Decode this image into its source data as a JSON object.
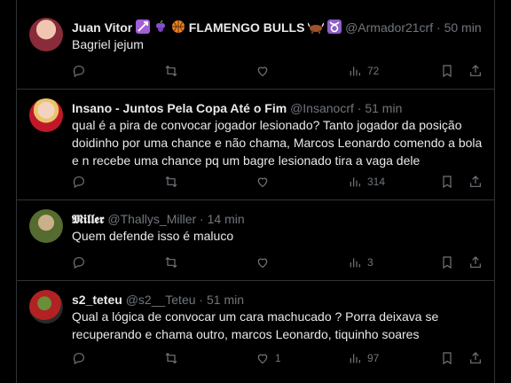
{
  "tweets": [
    {
      "name": "Juan Vitor",
      "name_tail": "FLAMENGO BULLS",
      "handle": "@Armador21crf",
      "time": "50 min",
      "text": "Bagriel jejum",
      "likes": "",
      "views": "72"
    },
    {
      "name": "Insano - Juntos Pela Copa Até o Fim",
      "handle": "@Insanocrf",
      "time": "51 min",
      "text_lines": [
        "qual é a pira de convocar jogador lesionado? Tanto jogador da posição",
        "doidinho por uma chance e não chama, Marcos Leonardo comendo a bola",
        "e n recebe uma chance pq um bagre lesionado tira a vaga dele"
      ],
      "likes": "",
      "views": "314"
    },
    {
      "name": "𝕸𝖎𝖑𝖑𝖊𝖗",
      "handle": "@Thallys_Miller",
      "time": "14 min",
      "text": "Quem defende isso é maluco",
      "likes": "",
      "views": "3"
    },
    {
      "name": "s2_teteu",
      "handle": "@s2__Teteu",
      "time": "51 min",
      "text_lines": [
        "Qual a lógica de convocar um cara machucado ? Porra deixava se",
        "recuperando e chama outro, marcos Leonardo, tiquinho soares"
      ],
      "likes": "1",
      "views": "97"
    }
  ],
  "separator": "·",
  "icons": [
    "reply-icon",
    "retweet-icon",
    "like-icon",
    "views-icon",
    "bookmark-icon",
    "share-icon"
  ]
}
